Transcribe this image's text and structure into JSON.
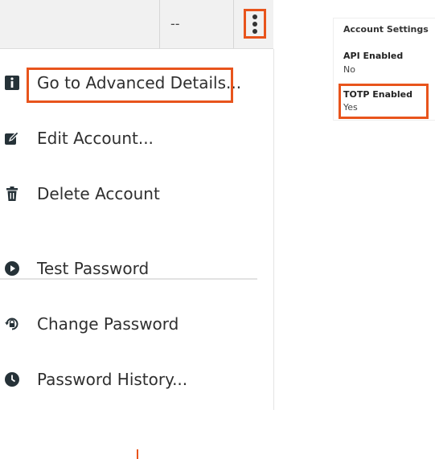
{
  "table_row": {
    "value": "--"
  },
  "menu": {
    "items": [
      {
        "label": "Go to Advanced Details...",
        "icon": "info-icon"
      },
      {
        "label": "Edit Account...",
        "icon": "edit-icon"
      },
      {
        "label": "Delete Account",
        "icon": "trash-icon"
      },
      {
        "label": "Test Password",
        "icon": "play-circle-icon"
      },
      {
        "label": "Change Password",
        "icon": "password-change-icon"
      },
      {
        "label": "Password History...",
        "icon": "clock-icon"
      }
    ]
  },
  "settings_panel": {
    "title": "Account Settings",
    "fields": [
      {
        "label": "API Enabled",
        "value": "No"
      },
      {
        "label": "TOTP Enabled",
        "value": "Yes"
      }
    ]
  },
  "colors": {
    "highlight": "#e8541c",
    "icon": "#263238",
    "header_bg": "#f1f1f1"
  }
}
